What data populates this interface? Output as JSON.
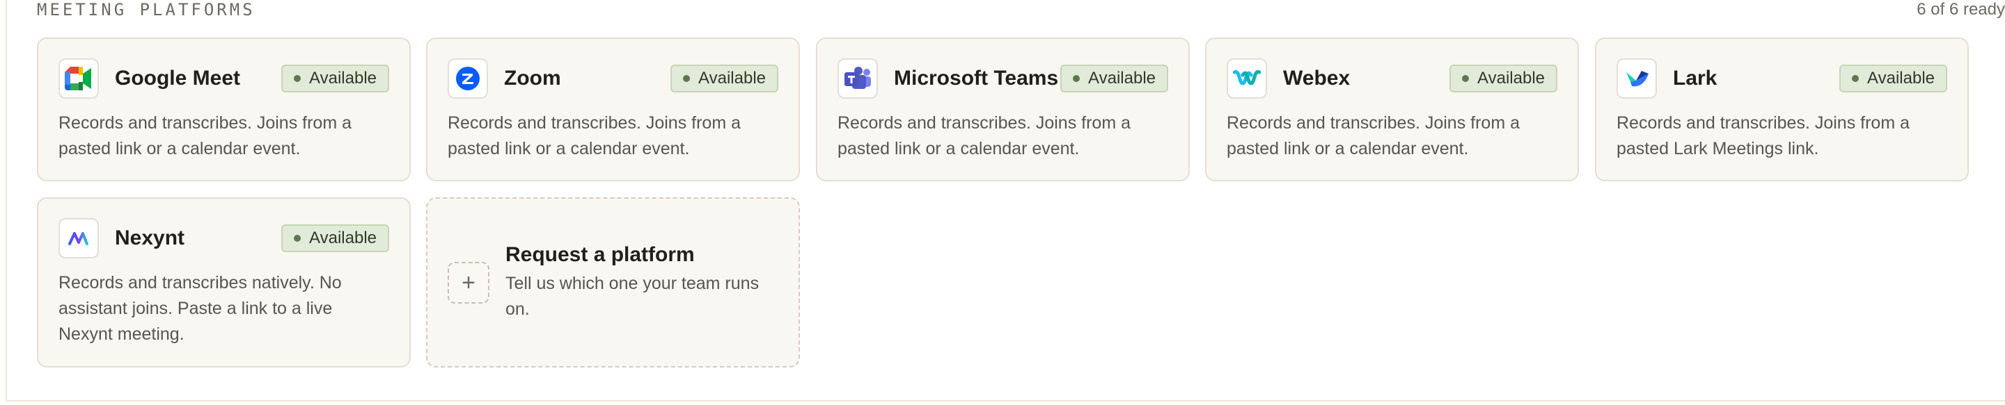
{
  "section": {
    "title": "MEETING PLATFORMS",
    "ready_count": "6 of 6 ready"
  },
  "platforms": [
    {
      "name": "Google Meet",
      "status": "Available",
      "description": "Records and transcribes. Joins from a pasted link or a calendar event.",
      "icon": "google-meet-icon"
    },
    {
      "name": "Zoom",
      "status": "Available",
      "description": "Records and transcribes. Joins from a pasted link or a calendar event.",
      "icon": "zoom-icon"
    },
    {
      "name": "Microsoft Teams",
      "status": "Available",
      "description": "Records and transcribes. Joins from a pasted link or a calendar event.",
      "icon": "microsoft-teams-icon"
    },
    {
      "name": "Webex",
      "status": "Available",
      "description": "Records and transcribes. Joins from a pasted link or a calendar event.",
      "icon": "webex-icon"
    },
    {
      "name": "Lark",
      "status": "Available",
      "description": "Records and transcribes. Joins from a pasted Lark Meetings link.",
      "icon": "lark-icon"
    },
    {
      "name": "Nexynt",
      "status": "Available",
      "description": "Records and transcribes natively. No assistant joins. Paste a link to a live Nexynt meeting.",
      "icon": "nexynt-icon"
    }
  ],
  "request": {
    "title": "Request a platform",
    "subtitle": "Tell us which one your team runs on.",
    "icon": "plus-icon",
    "plus_glyph": "+"
  },
  "colors": {
    "card_background": "#f9f7f1",
    "card_border": "#e4dfd3",
    "badge_background": "#e2ebd9",
    "badge_border": "#c5d6b6",
    "badge_dot": "#5c7a4c"
  }
}
